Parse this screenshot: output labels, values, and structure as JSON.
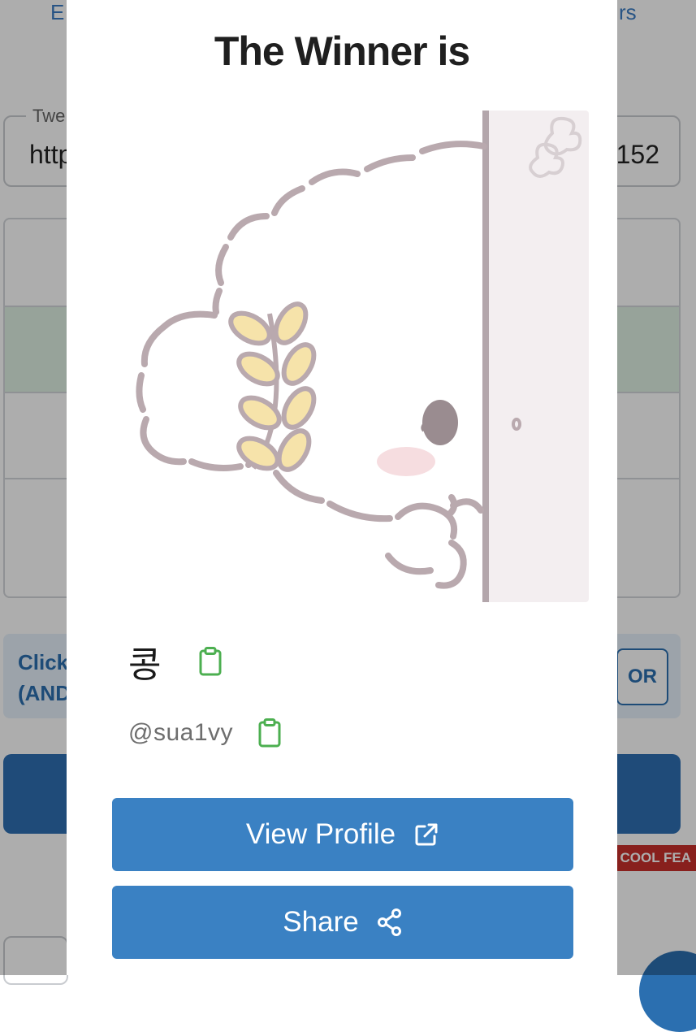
{
  "background": {
    "tab_left_text": "E",
    "tab_right_text": "rs",
    "field_label": "Twe",
    "field_value_left": "http",
    "field_value_right": "152",
    "info_text": "Click\n(AND",
    "or_label": "OR",
    "badge_text": "COOL FEA"
  },
  "modal": {
    "title": "The Winner is",
    "avatar_icon": "puppy-peek-illustration",
    "winner": {
      "name": "콩",
      "handle": "@sua1vy"
    },
    "copy_icon": "clipboard-icon",
    "buttons": {
      "view_profile": {
        "label": "View Profile",
        "icon": "external-link-icon"
      },
      "share": {
        "label": "Share",
        "icon": "share-icon"
      }
    }
  },
  "colors": {
    "primary_button": "#3a81c3",
    "copy_icon": "#4caf50",
    "overlay": "rgba(0,0,0,0.32)"
  }
}
